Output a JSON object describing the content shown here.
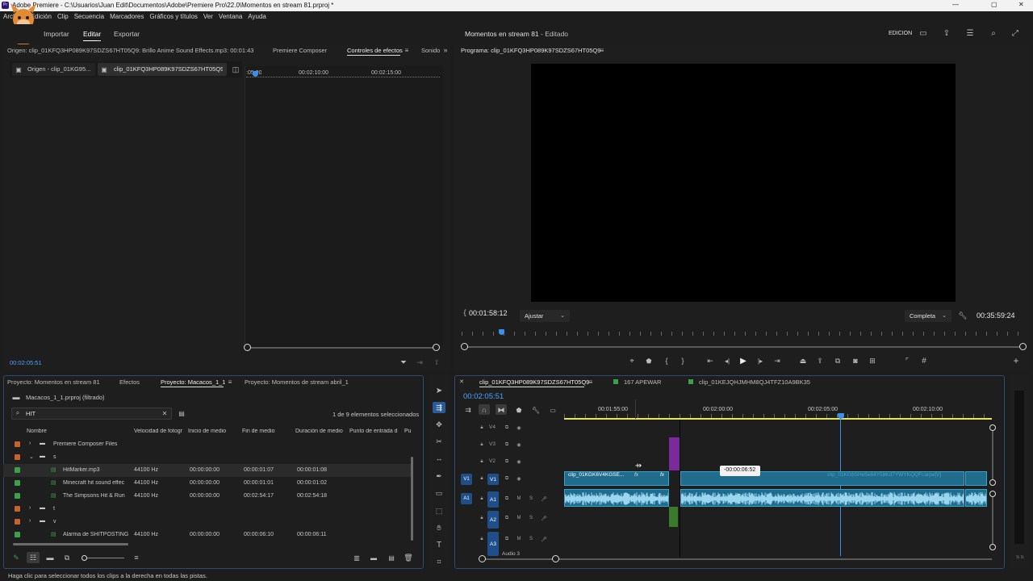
{
  "titlebar": {
    "app_icon": "Pr",
    "title": "Adobe Premiere - C:\\Usuarios\\Juan Edit\\Documentos\\Adobe\\Premiere Pro\\22.0\\Momentos en stream 81.prproj *",
    "min": "—",
    "max": "▢",
    "close": "✕"
  },
  "menubar": [
    "Archivo",
    "Edición",
    "Clip",
    "Secuencia",
    "Marcadores",
    "Gráficos y títulos",
    "Ver",
    "Ventana",
    "Ayuda"
  ],
  "header": {
    "nav": [
      "Importar",
      "Editar",
      "Exportar"
    ],
    "active_nav": "Editar",
    "project_title": "Momentos en stream 81",
    "project_state": "- Editado",
    "workspace": "EDICIÓN"
  },
  "source_panel": {
    "tabs": [
      "Origen: clip_01KFQ3HP089K97SDZS67HT05Q9: Brillo Anime Sound Effects.mp3: 00:01:43:24",
      "Premiere Composer",
      "Controles de efectos",
      "Sonido"
    ],
    "active_tab": "Controles de efectos",
    "subtabs": [
      "Origen - clip_01KG95...",
      "clip_01KFQ3HP089K97SDZS67HT05Q9..."
    ],
    "ruler": [
      ":05:00",
      "00:02:10:00",
      "00:02:15:00"
    ],
    "timecode": "00:02:05:51"
  },
  "program_panel": {
    "title": "Programa: clip_01KFQ3HP089K97SDZS67HT05Q9",
    "timecode_left": "00:01:58:12",
    "fit": "Ajustar",
    "quality": "Completa",
    "timecode_right": "00:35:59:24",
    "playhead_fraction": 0.07
  },
  "project_panel": {
    "tabs": [
      "Proyecto: Momentos en stream 81",
      "Efectos",
      "Proyecto: Macacos_1_1",
      "Proyecto: Momentos de stream abril_1"
    ],
    "active_tab": "Proyecto: Macacos_1_1",
    "file": "Macacos_1_1.prproj (filtrado)",
    "search_value": "HIT",
    "selection_count": "1 de 9 elementos seleccionados",
    "columns": [
      "Nombre",
      "Velocidad de fotogr",
      "Inicio de medio",
      "Fin de medio",
      "Duración de medio",
      "Punto de entrada d",
      "Pu"
    ],
    "rows": [
      {
        "kind": "folder",
        "indent": 0,
        "expanded": false,
        "color": "#c8642a",
        "name": "Premiere Composer Files",
        "rate": "",
        "start": "",
        "end": "",
        "dur": ""
      },
      {
        "kind": "folder",
        "indent": 0,
        "expanded": true,
        "color": "#c8642a",
        "name": "s",
        "rate": "",
        "start": "",
        "end": "",
        "dur": ""
      },
      {
        "kind": "audio",
        "indent": 1,
        "selected": true,
        "color": "#3aa14a",
        "name": "HitMarker.mp3",
        "rate": "44100 Hz",
        "start": "00:00:00:00",
        "end": "00:00:01:07",
        "dur": "00:00:01:08"
      },
      {
        "kind": "audio",
        "indent": 1,
        "color": "#3aa14a",
        "name": "Minecraft hit sound effec",
        "rate": "44100 Hz",
        "start": "00:00:00:00",
        "end": "00:00:01:01",
        "dur": "00:00:01:02"
      },
      {
        "kind": "audio",
        "indent": 1,
        "color": "#3aa14a",
        "name": "The Simpsons Hit & Run",
        "rate": "44100 Hz",
        "start": "00:00:00:00",
        "end": "00:02:54:17",
        "dur": "00:02:54:18"
      },
      {
        "kind": "folder",
        "indent": 0,
        "expanded": false,
        "color": "#c8642a",
        "name": "t",
        "rate": "",
        "start": "",
        "end": "",
        "dur": ""
      },
      {
        "kind": "folder",
        "indent": 0,
        "expanded": false,
        "color": "#c8642a",
        "name": "v",
        "rate": "",
        "start": "",
        "end": "",
        "dur": ""
      },
      {
        "kind": "audio",
        "indent": 1,
        "color": "#3aa14a",
        "name": "Alarma de SHITPOSTING son",
        "rate": "44100 Hz",
        "start": "00:00:00:00",
        "end": "00:00:06:10",
        "dur": "00:00:06:11"
      }
    ]
  },
  "timeline": {
    "tabs": [
      "clip_01KFQ3HP089K97SDZS67HT05Q9",
      "167 APEWAR",
      "clip_01KEJQHJMHM8QJ4TFZ10A9BK35"
    ],
    "active_tab": "clip_01KFQ3HP089K97SDZS67HT05Q9",
    "timecode": "00:02:05:51",
    "ruler": [
      "00:01:55:00",
      "00:02:00:00",
      "00:02:05:00",
      "00:02:10:00"
    ],
    "tracks_video": [
      "V4",
      "V3",
      "V2",
      "V1"
    ],
    "tracks_audio": [
      "A1",
      "A2",
      "A3"
    ],
    "source_patch_v": "V1",
    "source_patch_a": "A1",
    "clip_v1_left": "clip_01KGK6V4KGSE...",
    "clip_v1_right": "clip_01KG8SHe5e64Y58Kd7YWYKQQFcarpe[V]",
    "fx": "fx",
    "track_name_a3": "Audio 3",
    "tooltip": "-00:00:06:52"
  },
  "statusbar": {
    "text": "Haga clic para seleccionar todos los clips a la derecha en todas las pistas."
  }
}
